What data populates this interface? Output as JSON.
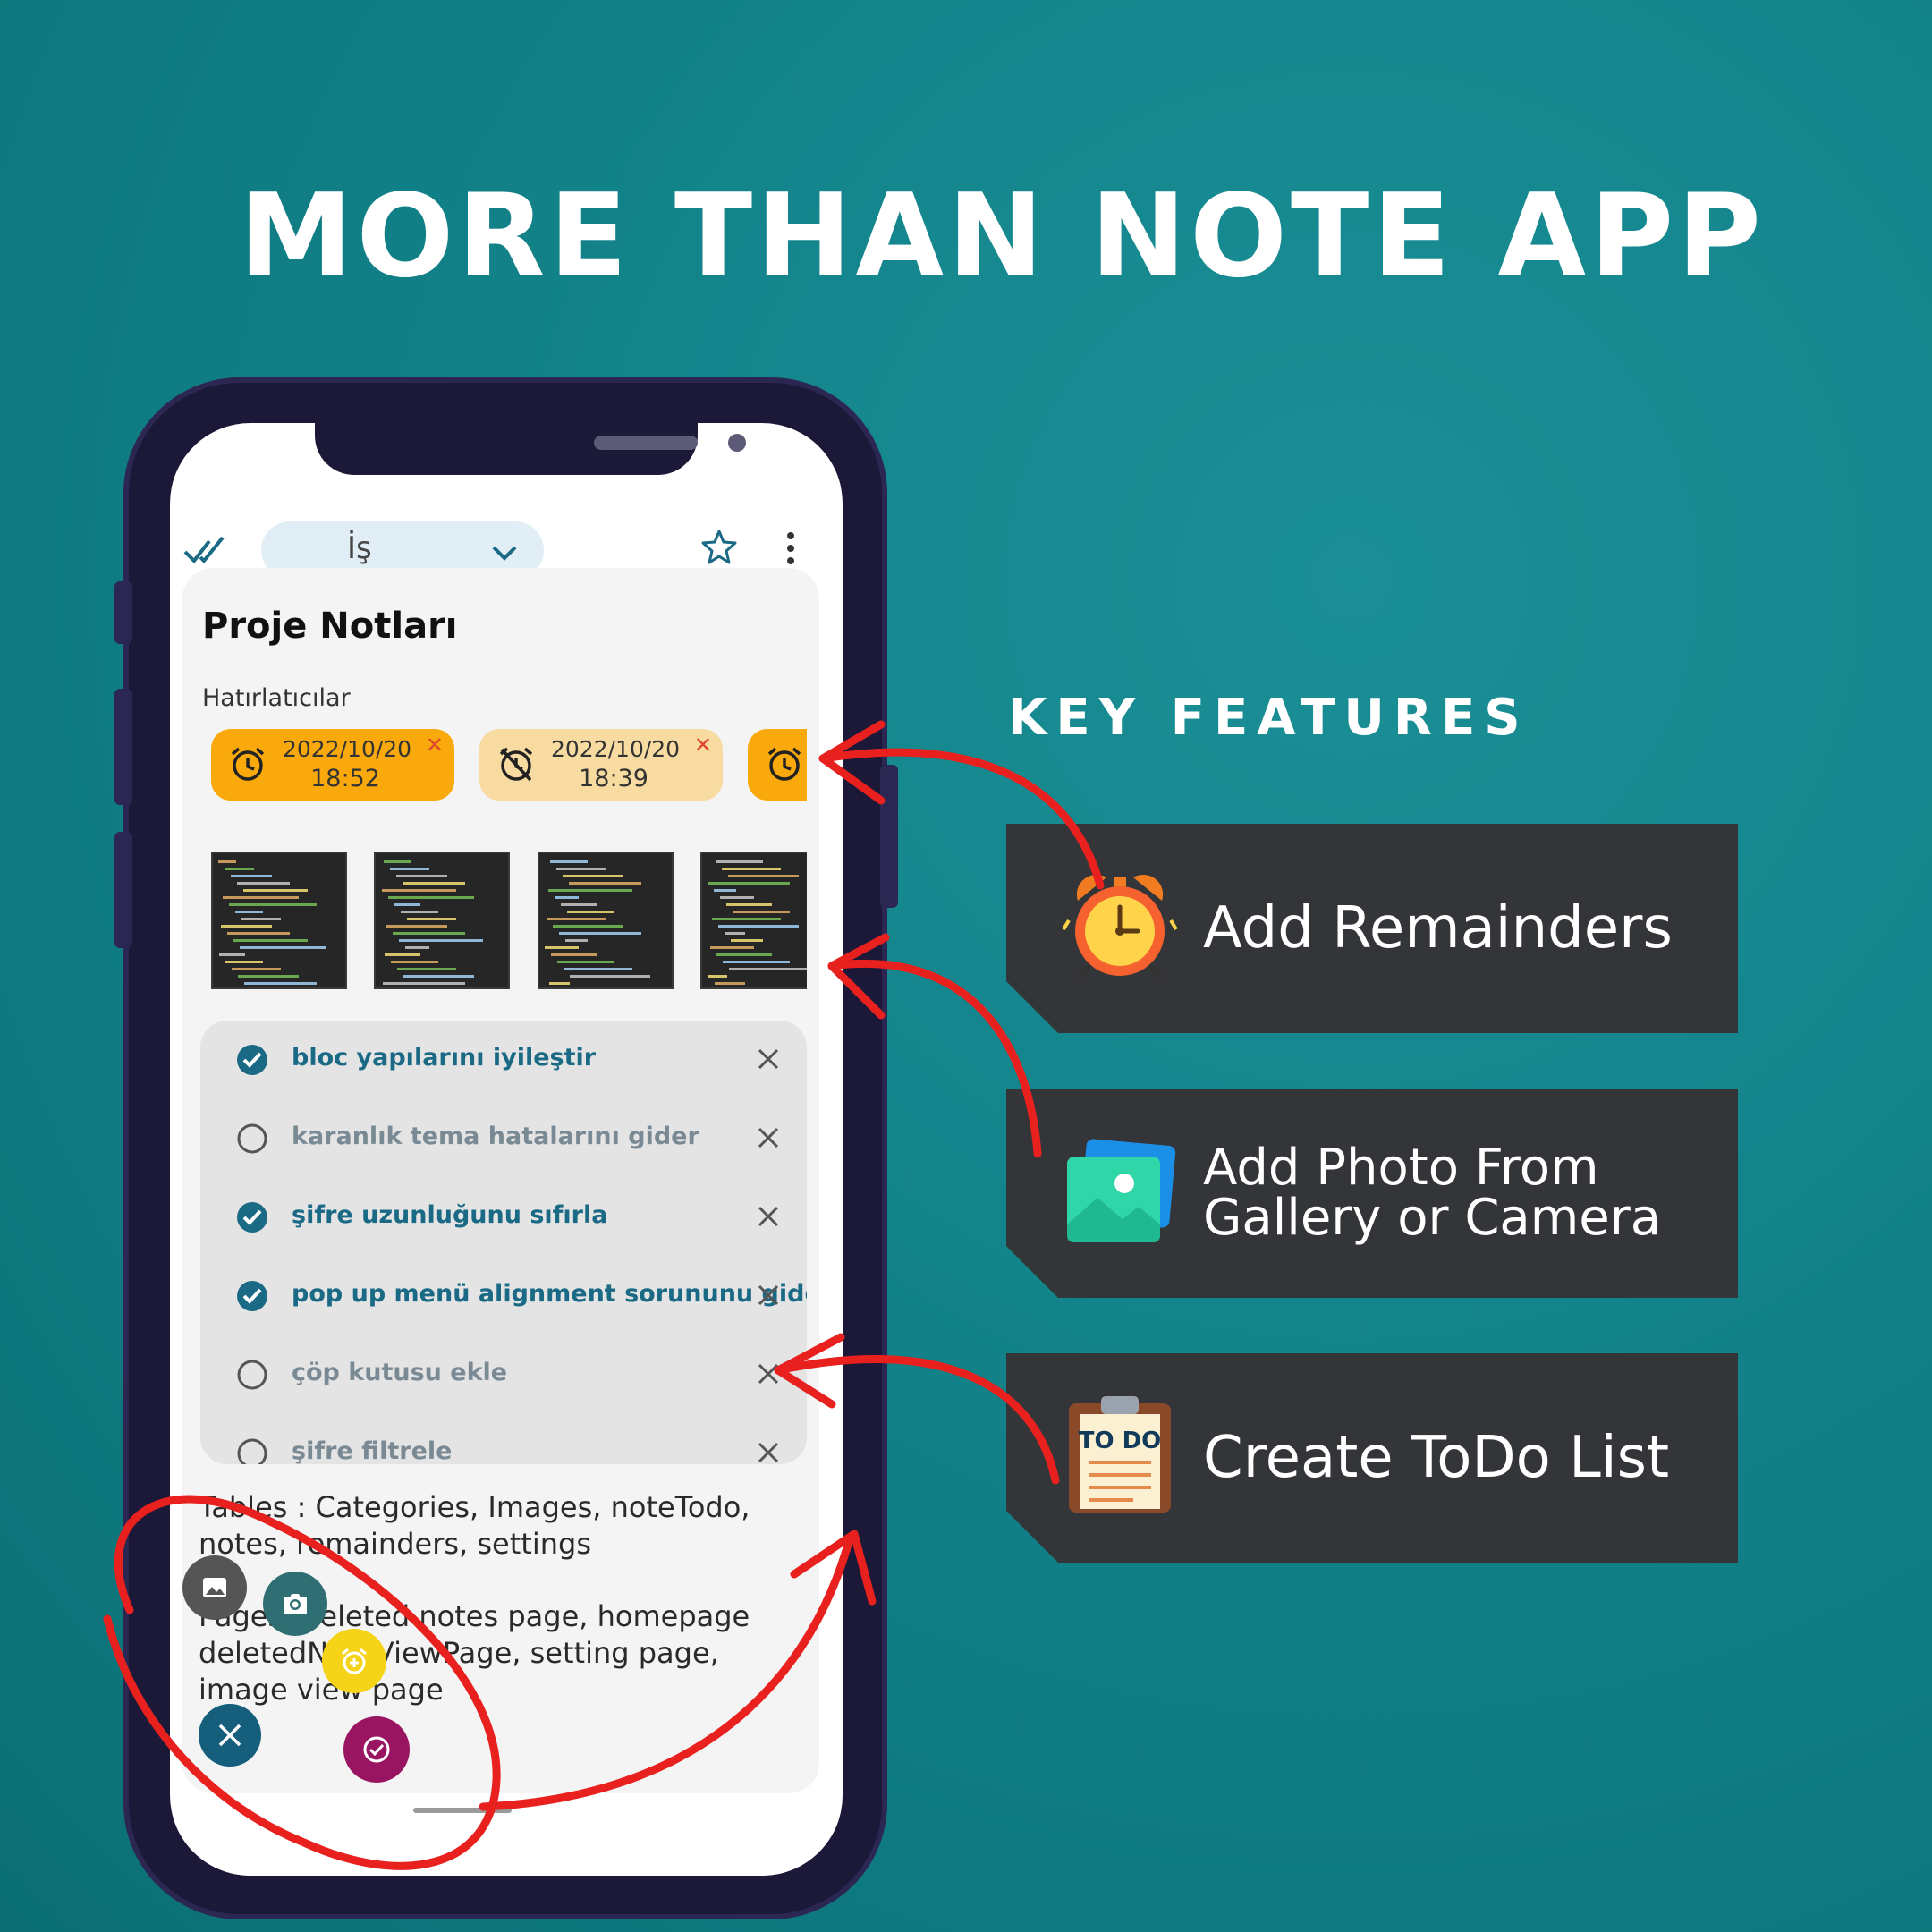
{
  "headline": "MORE THAN NOTE APP",
  "key_features_title": "KEY FEATURES",
  "features": [
    {
      "label": "Add Remainders",
      "icon": "alarm-clock-icon"
    },
    {
      "label": "Add Photo From\nGallery or Camera",
      "icon": "gallery-photo-icon"
    },
    {
      "label": "Create ToDo List",
      "icon": "todo-clipboard-icon"
    }
  ],
  "app": {
    "category": "İş",
    "note_title": "Proje Notları",
    "reminders_label": "Hatırlatıcılar",
    "reminders": [
      {
        "date": "2022/10/20",
        "time": "18:52",
        "color": "#f9a90b",
        "state": "active"
      },
      {
        "date": "2022/10/20",
        "time": "18:39",
        "color": "#f8dba0",
        "state": "off"
      },
      {
        "date": "",
        "time": "",
        "color": "#f9a90b",
        "state": "active"
      }
    ],
    "todos": [
      {
        "text": "bloc yapılarını iyileştir",
        "done": true
      },
      {
        "text": "karanlık tema hatalarını gider",
        "done": false
      },
      {
        "text": "şifre uzunluğunu sıfırla",
        "done": true
      },
      {
        "text": "pop up menü alignment sorununu gider",
        "done": true
      },
      {
        "text": "çöp kutusu ekle",
        "done": false
      },
      {
        "text": "şifre filtrele",
        "done": false
      }
    ],
    "body_paragraph_1": "Tables : Categories, Images, noteTodo, notes, remainders, settings",
    "body_paragraph_2": "Pages: deleted notes page, homepage deletedNoteViewPage, setting page, image view page"
  },
  "colors": {
    "todo_done": "#1a6a86",
    "todo_pending": "#7a8a94",
    "fab_close": "#155f7c",
    "fab_camera": "#2f6e72",
    "fab_image": "#555555",
    "fab_alarm": "#f5d319",
    "fab_todo": "#9a1561",
    "arrow_red": "#e8201e"
  }
}
